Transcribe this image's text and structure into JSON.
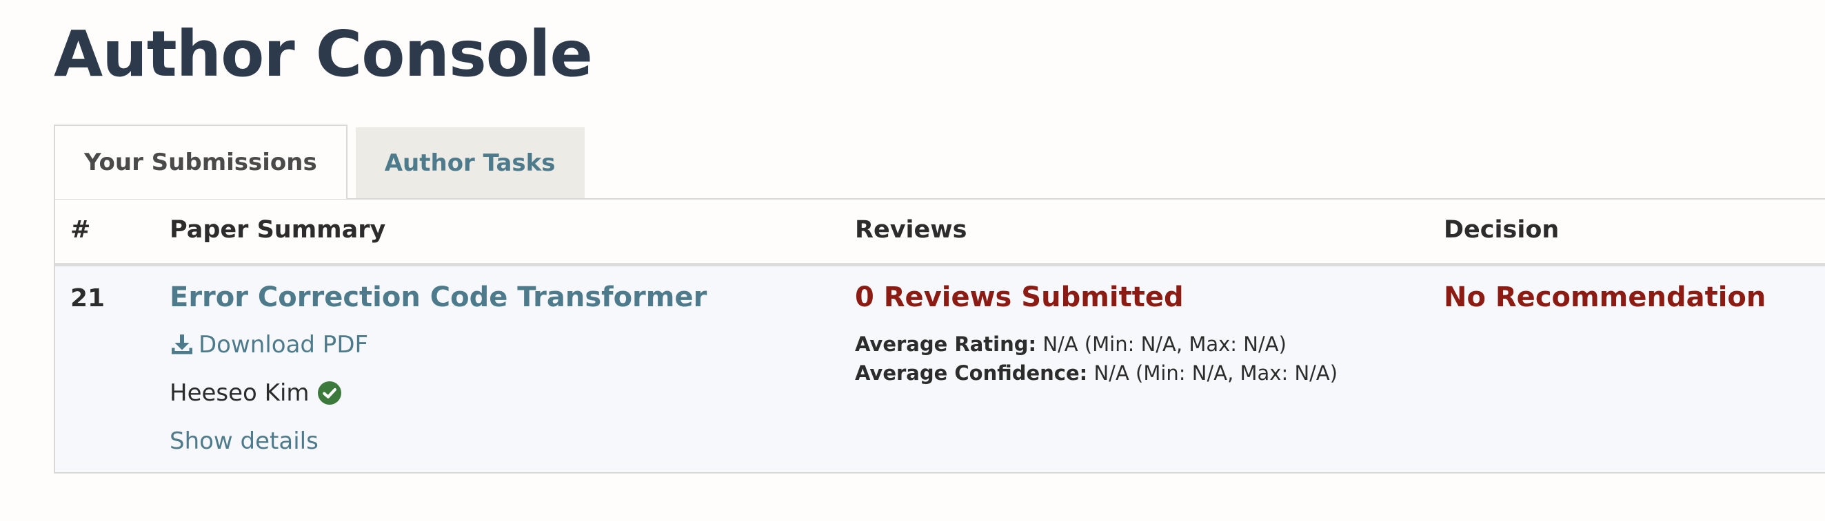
{
  "page": {
    "title": "Author Console"
  },
  "tabs": [
    {
      "label": "Your Submissions",
      "active": true
    },
    {
      "label": "Author Tasks",
      "active": false
    }
  ],
  "table": {
    "headers": {
      "num": "#",
      "summary": "Paper Summary",
      "reviews": "Reviews",
      "decision": "Decision"
    },
    "rows": [
      {
        "number": "21",
        "title": "Error Correction Code Transformer",
        "download_label": "Download PDF",
        "author": "Heeseo Kim",
        "show_details": "Show details",
        "reviews_submitted": "0 Reviews Submitted",
        "avg_rating_label": "Average Rating:",
        "avg_rating_value": "N/A (Min: N/A, Max: N/A)",
        "avg_confidence_label": "Average Confidence:",
        "avg_confidence_value": "N/A (Min: N/A, Max: N/A)",
        "decision": "No Recommendation"
      }
    ]
  },
  "icons": {
    "download": "download-icon",
    "verified": "verified-check-icon"
  },
  "colors": {
    "link": "#4e7b8c",
    "alert": "#8c1b13",
    "verified": "#3c7a3c",
    "title": "#2c3a4b"
  }
}
